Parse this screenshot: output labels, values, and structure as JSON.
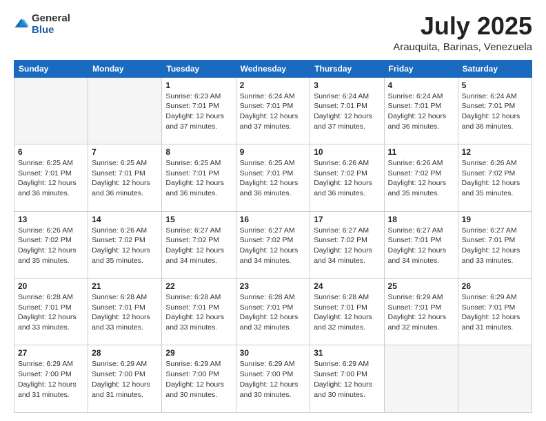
{
  "logo": {
    "general": "General",
    "blue": "Blue"
  },
  "header": {
    "month_year": "July 2025",
    "location": "Arauquita, Barinas, Venezuela"
  },
  "weekdays": [
    "Sunday",
    "Monday",
    "Tuesday",
    "Wednesday",
    "Thursday",
    "Friday",
    "Saturday"
  ],
  "weeks": [
    [
      {
        "day": "",
        "empty": true
      },
      {
        "day": "",
        "empty": true
      },
      {
        "day": "1",
        "sunrise": "6:23 AM",
        "sunset": "7:01 PM",
        "daylight": "12 hours and 37 minutes."
      },
      {
        "day": "2",
        "sunrise": "6:24 AM",
        "sunset": "7:01 PM",
        "daylight": "12 hours and 37 minutes."
      },
      {
        "day": "3",
        "sunrise": "6:24 AM",
        "sunset": "7:01 PM",
        "daylight": "12 hours and 37 minutes."
      },
      {
        "day": "4",
        "sunrise": "6:24 AM",
        "sunset": "7:01 PM",
        "daylight": "12 hours and 36 minutes."
      },
      {
        "day": "5",
        "sunrise": "6:24 AM",
        "sunset": "7:01 PM",
        "daylight": "12 hours and 36 minutes."
      }
    ],
    [
      {
        "day": "6",
        "sunrise": "6:25 AM",
        "sunset": "7:01 PM",
        "daylight": "12 hours and 36 minutes."
      },
      {
        "day": "7",
        "sunrise": "6:25 AM",
        "sunset": "7:01 PM",
        "daylight": "12 hours and 36 minutes."
      },
      {
        "day": "8",
        "sunrise": "6:25 AM",
        "sunset": "7:01 PM",
        "daylight": "12 hours and 36 minutes."
      },
      {
        "day": "9",
        "sunrise": "6:25 AM",
        "sunset": "7:01 PM",
        "daylight": "12 hours and 36 minutes."
      },
      {
        "day": "10",
        "sunrise": "6:26 AM",
        "sunset": "7:02 PM",
        "daylight": "12 hours and 36 minutes."
      },
      {
        "day": "11",
        "sunrise": "6:26 AM",
        "sunset": "7:02 PM",
        "daylight": "12 hours and 35 minutes."
      },
      {
        "day": "12",
        "sunrise": "6:26 AM",
        "sunset": "7:02 PM",
        "daylight": "12 hours and 35 minutes."
      }
    ],
    [
      {
        "day": "13",
        "sunrise": "6:26 AM",
        "sunset": "7:02 PM",
        "daylight": "12 hours and 35 minutes."
      },
      {
        "day": "14",
        "sunrise": "6:26 AM",
        "sunset": "7:02 PM",
        "daylight": "12 hours and 35 minutes."
      },
      {
        "day": "15",
        "sunrise": "6:27 AM",
        "sunset": "7:02 PM",
        "daylight": "12 hours and 34 minutes."
      },
      {
        "day": "16",
        "sunrise": "6:27 AM",
        "sunset": "7:02 PM",
        "daylight": "12 hours and 34 minutes."
      },
      {
        "day": "17",
        "sunrise": "6:27 AM",
        "sunset": "7:02 PM",
        "daylight": "12 hours and 34 minutes."
      },
      {
        "day": "18",
        "sunrise": "6:27 AM",
        "sunset": "7:01 PM",
        "daylight": "12 hours and 34 minutes."
      },
      {
        "day": "19",
        "sunrise": "6:27 AM",
        "sunset": "7:01 PM",
        "daylight": "12 hours and 33 minutes."
      }
    ],
    [
      {
        "day": "20",
        "sunrise": "6:28 AM",
        "sunset": "7:01 PM",
        "daylight": "12 hours and 33 minutes."
      },
      {
        "day": "21",
        "sunrise": "6:28 AM",
        "sunset": "7:01 PM",
        "daylight": "12 hours and 33 minutes."
      },
      {
        "day": "22",
        "sunrise": "6:28 AM",
        "sunset": "7:01 PM",
        "daylight": "12 hours and 33 minutes."
      },
      {
        "day": "23",
        "sunrise": "6:28 AM",
        "sunset": "7:01 PM",
        "daylight": "12 hours and 32 minutes."
      },
      {
        "day": "24",
        "sunrise": "6:28 AM",
        "sunset": "7:01 PM",
        "daylight": "12 hours and 32 minutes."
      },
      {
        "day": "25",
        "sunrise": "6:29 AM",
        "sunset": "7:01 PM",
        "daylight": "12 hours and 32 minutes."
      },
      {
        "day": "26",
        "sunrise": "6:29 AM",
        "sunset": "7:01 PM",
        "daylight": "12 hours and 31 minutes."
      }
    ],
    [
      {
        "day": "27",
        "sunrise": "6:29 AM",
        "sunset": "7:00 PM",
        "daylight": "12 hours and 31 minutes."
      },
      {
        "day": "28",
        "sunrise": "6:29 AM",
        "sunset": "7:00 PM",
        "daylight": "12 hours and 31 minutes."
      },
      {
        "day": "29",
        "sunrise": "6:29 AM",
        "sunset": "7:00 PM",
        "daylight": "12 hours and 30 minutes."
      },
      {
        "day": "30",
        "sunrise": "6:29 AM",
        "sunset": "7:00 PM",
        "daylight": "12 hours and 30 minutes."
      },
      {
        "day": "31",
        "sunrise": "6:29 AM",
        "sunset": "7:00 PM",
        "daylight": "12 hours and 30 minutes."
      },
      {
        "day": "",
        "empty": true
      },
      {
        "day": "",
        "empty": true
      }
    ]
  ],
  "labels": {
    "sunrise": "Sunrise:",
    "sunset": "Sunset:",
    "daylight": "Daylight:"
  }
}
